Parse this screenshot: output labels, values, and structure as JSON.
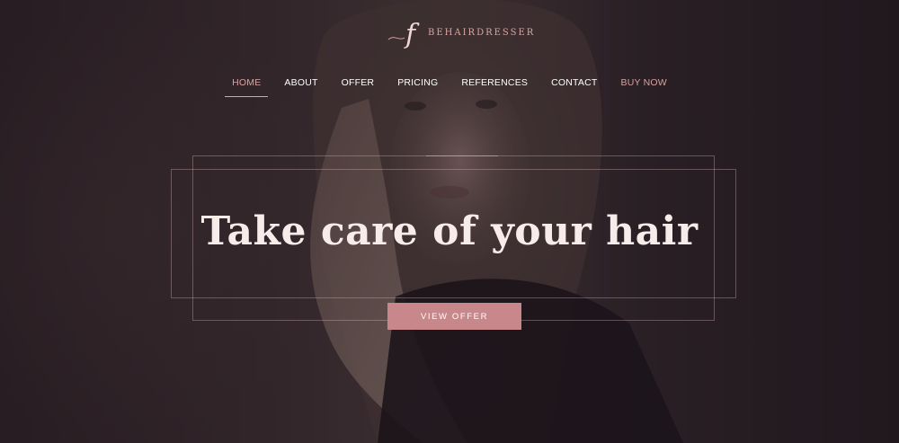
{
  "brand": {
    "logo_letter": "f",
    "name": "BEHAIRDRESSER",
    "accent_color": "#d9a3a3"
  },
  "nav": {
    "items": [
      {
        "label": "HOME",
        "active": true
      },
      {
        "label": "ABOUT",
        "active": false
      },
      {
        "label": "OFFER",
        "active": false
      },
      {
        "label": "PRICING",
        "active": false
      },
      {
        "label": "REFERENCES",
        "active": false
      },
      {
        "label": "CONTACT",
        "active": false
      },
      {
        "label": "BUY NOW",
        "active": false
      }
    ]
  },
  "hero": {
    "headline": "Take care of your hair",
    "cta_label": "VIEW OFFER",
    "cta_color": "#c8878b"
  }
}
